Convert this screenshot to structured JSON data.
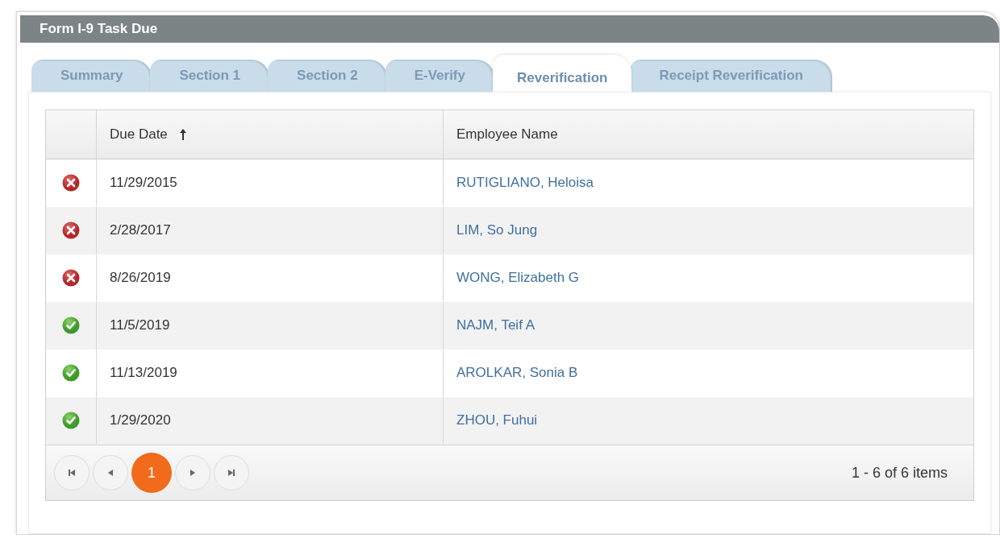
{
  "panel": {
    "title": "Form I-9 Task Due"
  },
  "tabs": [
    {
      "label": "Summary",
      "selected": false
    },
    {
      "label": "Section 1",
      "selected": false
    },
    {
      "label": "Section 2",
      "selected": false
    },
    {
      "label": "E-Verify",
      "selected": false
    },
    {
      "label": "Reverification",
      "selected": true
    },
    {
      "label": "Receipt Reverification",
      "selected": false
    }
  ],
  "table": {
    "columns": [
      {
        "label": "Due Date",
        "sorted_ascending": true
      },
      {
        "label": "Employee Name"
      }
    ],
    "rows": [
      {
        "kind": "error",
        "due_date": "11/29/2015",
        "employee": "RUTIGLIANO, Heloisa"
      },
      {
        "kind": "error",
        "due_date": "2/28/2017",
        "employee": "LIM, So Jung"
      },
      {
        "kind": "error",
        "due_date": "8/26/2019",
        "employee": "WONG, Elizabeth G"
      },
      {
        "kind": "ok",
        "due_date": "11/5/2019",
        "employee": "NAJM, Teif A"
      },
      {
        "kind": "ok",
        "due_date": "11/13/2019",
        "employee": "AROLKAR, Sonia B"
      },
      {
        "kind": "ok",
        "due_date": "1/29/2020",
        "employee": "ZHOU, Fuhui"
      }
    ]
  },
  "pager": {
    "pages": [
      {
        "label": "1",
        "selected": true
      }
    ],
    "summary": "1 - 6 of 6 items"
  }
}
